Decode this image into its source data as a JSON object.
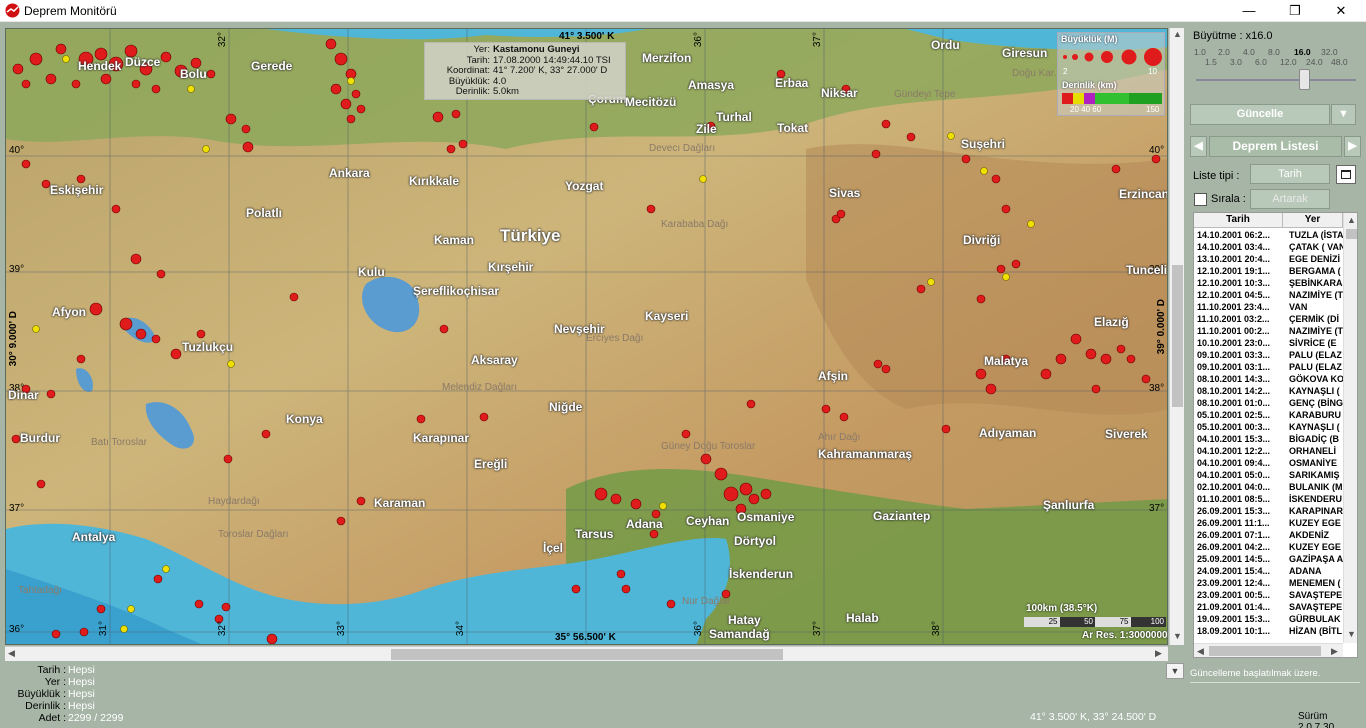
{
  "window": {
    "title": "Deprem Monitörü",
    "min": "—",
    "max": "❐",
    "close": "✕"
  },
  "map": {
    "top_coord": "41° 3.500' K",
    "bottom_coord": "35° 56.500' K",
    "left_coord": "30° 9.000' D",
    "right_coord": "39° 0.000' D",
    "lat_labels": [
      "40°",
      "39°",
      "38°",
      "37°",
      "36°"
    ],
    "lon_labels": [
      "31°",
      "32°",
      "33°",
      "34°",
      "35°",
      "36°",
      "37°",
      "38°"
    ],
    "cities": [
      "Hendek",
      "Düzce",
      "Bolu",
      "Gerede",
      "Merzifon",
      "Amasya",
      "Erbaa",
      "Giresun",
      "Ordu",
      "Çorum",
      "Mecitözü",
      "Turhal",
      "Zile",
      "Tokat",
      "Niksar",
      "Suşehri",
      "Eskişehir",
      "Ankara",
      "Kırıkkale",
      "Yozgat",
      "Sivas",
      "Erzincan",
      "Polatlı",
      "Kaman",
      "Divriği",
      "Kulu",
      "Kırşehir",
      "Şereflikoçhisar",
      "Tunceli",
      "Afyon",
      "Nevşehir",
      "Kayseri",
      "Elazığ",
      "Tuzlukçu",
      "Aksaray",
      "Malatya",
      "Dinar",
      "Afşin",
      "Niğde",
      "Konya",
      "Burdur",
      "Karapınar",
      "Adıyaman",
      "Siverek",
      "Ereğli",
      "Kahramanmaraş",
      "Karaman",
      "Şanlıurfa",
      "Antalya",
      "Tarsus",
      "Adana",
      "Ceyhan",
      "Osmaniye",
      "Gaziantep",
      "İçel",
      "Dörtyol",
      "İskenderun",
      "Hatay",
      "Halab",
      "Samandağ"
    ],
    "country": "Türkiye",
    "features": [
      "Devecı Dağları",
      "Karababa Dağı",
      "Gündeyi Tepe",
      "Ercıyes Dağı",
      "Melendiz Dağları",
      "Batı Toroslar",
      "Güney Doğu Toroslar",
      "Ahır Dağı",
      "Haydardağı",
      "Toroslar Dağları",
      "Tahtadağı",
      "Nur Dağlar",
      "Doğu Kar..."
    ],
    "info": {
      "yer_label": "Yer:",
      "yer": "Kastamonu Guneyi",
      "tarih_label": "Tarih:",
      "tarih": "17.08.2000 14:49:44.10 TSI",
      "koordinat_label": "Koordinat:",
      "koordinat": "41° 7.200' K, 33° 27.000' D",
      "buyukluk_label": "Büyüklük:",
      "buyukluk": "4.0",
      "derinlik_label": "Derinlik:",
      "derinlik": "5.0km"
    },
    "legend": {
      "mag_title": "Büyüklük (M)",
      "mag_min": "2",
      "mag_max": "10",
      "depth_title": "Derinlik (km)",
      "depth_ticks": "20 40 60",
      "depth_max": "150"
    },
    "scale": {
      "title": "100km (38.5°K)",
      "ticks": [
        "25",
        "50",
        "75",
        "100"
      ],
      "ratio": "Ar Res. 1:3000000"
    },
    "colors": {
      "sea": "#4fb6d8",
      "land": "#c9a96e",
      "event": "#e01b1b",
      "event_shallow_yellow": "#e6dc00"
    }
  },
  "right_panel": {
    "zoom_label": "Büyütme : x16.0",
    "zoom_ticks_top": [
      "1.0",
      "2.0",
      "4.0",
      "8.0",
      "16.0",
      "32.0"
    ],
    "zoom_ticks_bottom": [
      "1.5",
      "3.0",
      "6.0",
      "12.0",
      "24.0",
      "48.0"
    ],
    "zoom_selected": "16.0",
    "update_btn": "Güncelle",
    "update_drop": "▼",
    "list_tab": "Deprem Listesi",
    "list_tab_left": "◀",
    "list_tab_right": "▶",
    "list_type_label": "Liste tipi :",
    "list_type_value": "Tarih",
    "sort_label": "Sırala :",
    "sort_value": "Artarak",
    "columns": [
      "Tarih",
      "Yer"
    ],
    "rows": [
      [
        "14.10.2001 06:2...",
        "TUZLA (İSTA"
      ],
      [
        "14.10.2001 03:4...",
        "ÇATAK ( VAN"
      ],
      [
        "13.10.2001 20:4...",
        "EGE DENİZİ"
      ],
      [
        "12.10.2001 19:1...",
        "BERGAMA ("
      ],
      [
        "12.10.2001 10:3...",
        "ŞEBİNKARA"
      ],
      [
        "12.10.2001 04:5...",
        "NAZIMİYE (T"
      ],
      [
        "11.10.2001 23:4...",
        "VAN"
      ],
      [
        "11.10.2001 03:2...",
        "ÇERMİK (Dİ"
      ],
      [
        "11.10.2001 00:2...",
        "NAZIMİYE (T"
      ],
      [
        "10.10.2001 23:0...",
        "SİVRİCE (E"
      ],
      [
        "09.10.2001 03:3...",
        "PALU (ELAZ"
      ],
      [
        "09.10.2001 03:1...",
        "PALU (ELAZ"
      ],
      [
        "08.10.2001 14:3...",
        "GÖKOVA KO"
      ],
      [
        "08.10.2001 14:2...",
        "KAYNAŞLI ("
      ],
      [
        "08.10.2001 01:0...",
        "GENÇ (BİNG"
      ],
      [
        "05.10.2001 02:5...",
        "KARABURU"
      ],
      [
        "05.10.2001 00:3...",
        "KAYNAŞLI ("
      ],
      [
        "04.10.2001 15:3...",
        "BİGADİÇ (B"
      ],
      [
        "04.10.2001 12:2...",
        "ORHANELİ"
      ],
      [
        "04.10.2001 09:4...",
        "OSMANİYE"
      ],
      [
        "04.10.2001 05:0...",
        "SARIKAMIŞ"
      ],
      [
        "02.10.2001 04:0...",
        "BULANIK (M"
      ],
      [
        "01.10.2001 08:5...",
        "İSKENDERU"
      ],
      [
        "26.09.2001 15:3...",
        "KARAPINAR"
      ],
      [
        "26.09.2001 11:1...",
        "KUZEY EGE"
      ],
      [
        "26.09.2001 07:1...",
        "AKDENİZ"
      ],
      [
        "26.09.2001 04:2...",
        "KUZEY EGE"
      ],
      [
        "25.09.2001 14:5...",
        "GAZİPAŞA A"
      ],
      [
        "24.09.2001 15:4...",
        "ADANA"
      ],
      [
        "23.09.2001 12:4...",
        "MENEMEN ("
      ],
      [
        "23.09.2001 00:5...",
        "SAVAŞTEPE"
      ],
      [
        "21.09.2001 01:4...",
        "SAVAŞTEPE"
      ],
      [
        "19.09.2001 15:3...",
        "GÜRBULAK"
      ],
      [
        "18.09.2001 10:1...",
        "HİZAN (BİTL"
      ]
    ]
  },
  "filters": {
    "tarih_label": "Tarih :",
    "tarih": "Hepsi",
    "yer_label": "Yer :",
    "yer": "Hepsi",
    "buyukluk_label": "Büyüklük :",
    "buyukluk": "Hepsi",
    "derinlik_label": "Derinlik :",
    "derinlik": "Hepsi",
    "adet_label": "Adet :",
    "adet": "2299 / 2299"
  },
  "status": {
    "message": "Güncelleme başlatılmak üzere.",
    "cursor_coord": "41° 3.500' K, 33° 24.500' D",
    "version": "Sürüm 2.0.7.30"
  }
}
